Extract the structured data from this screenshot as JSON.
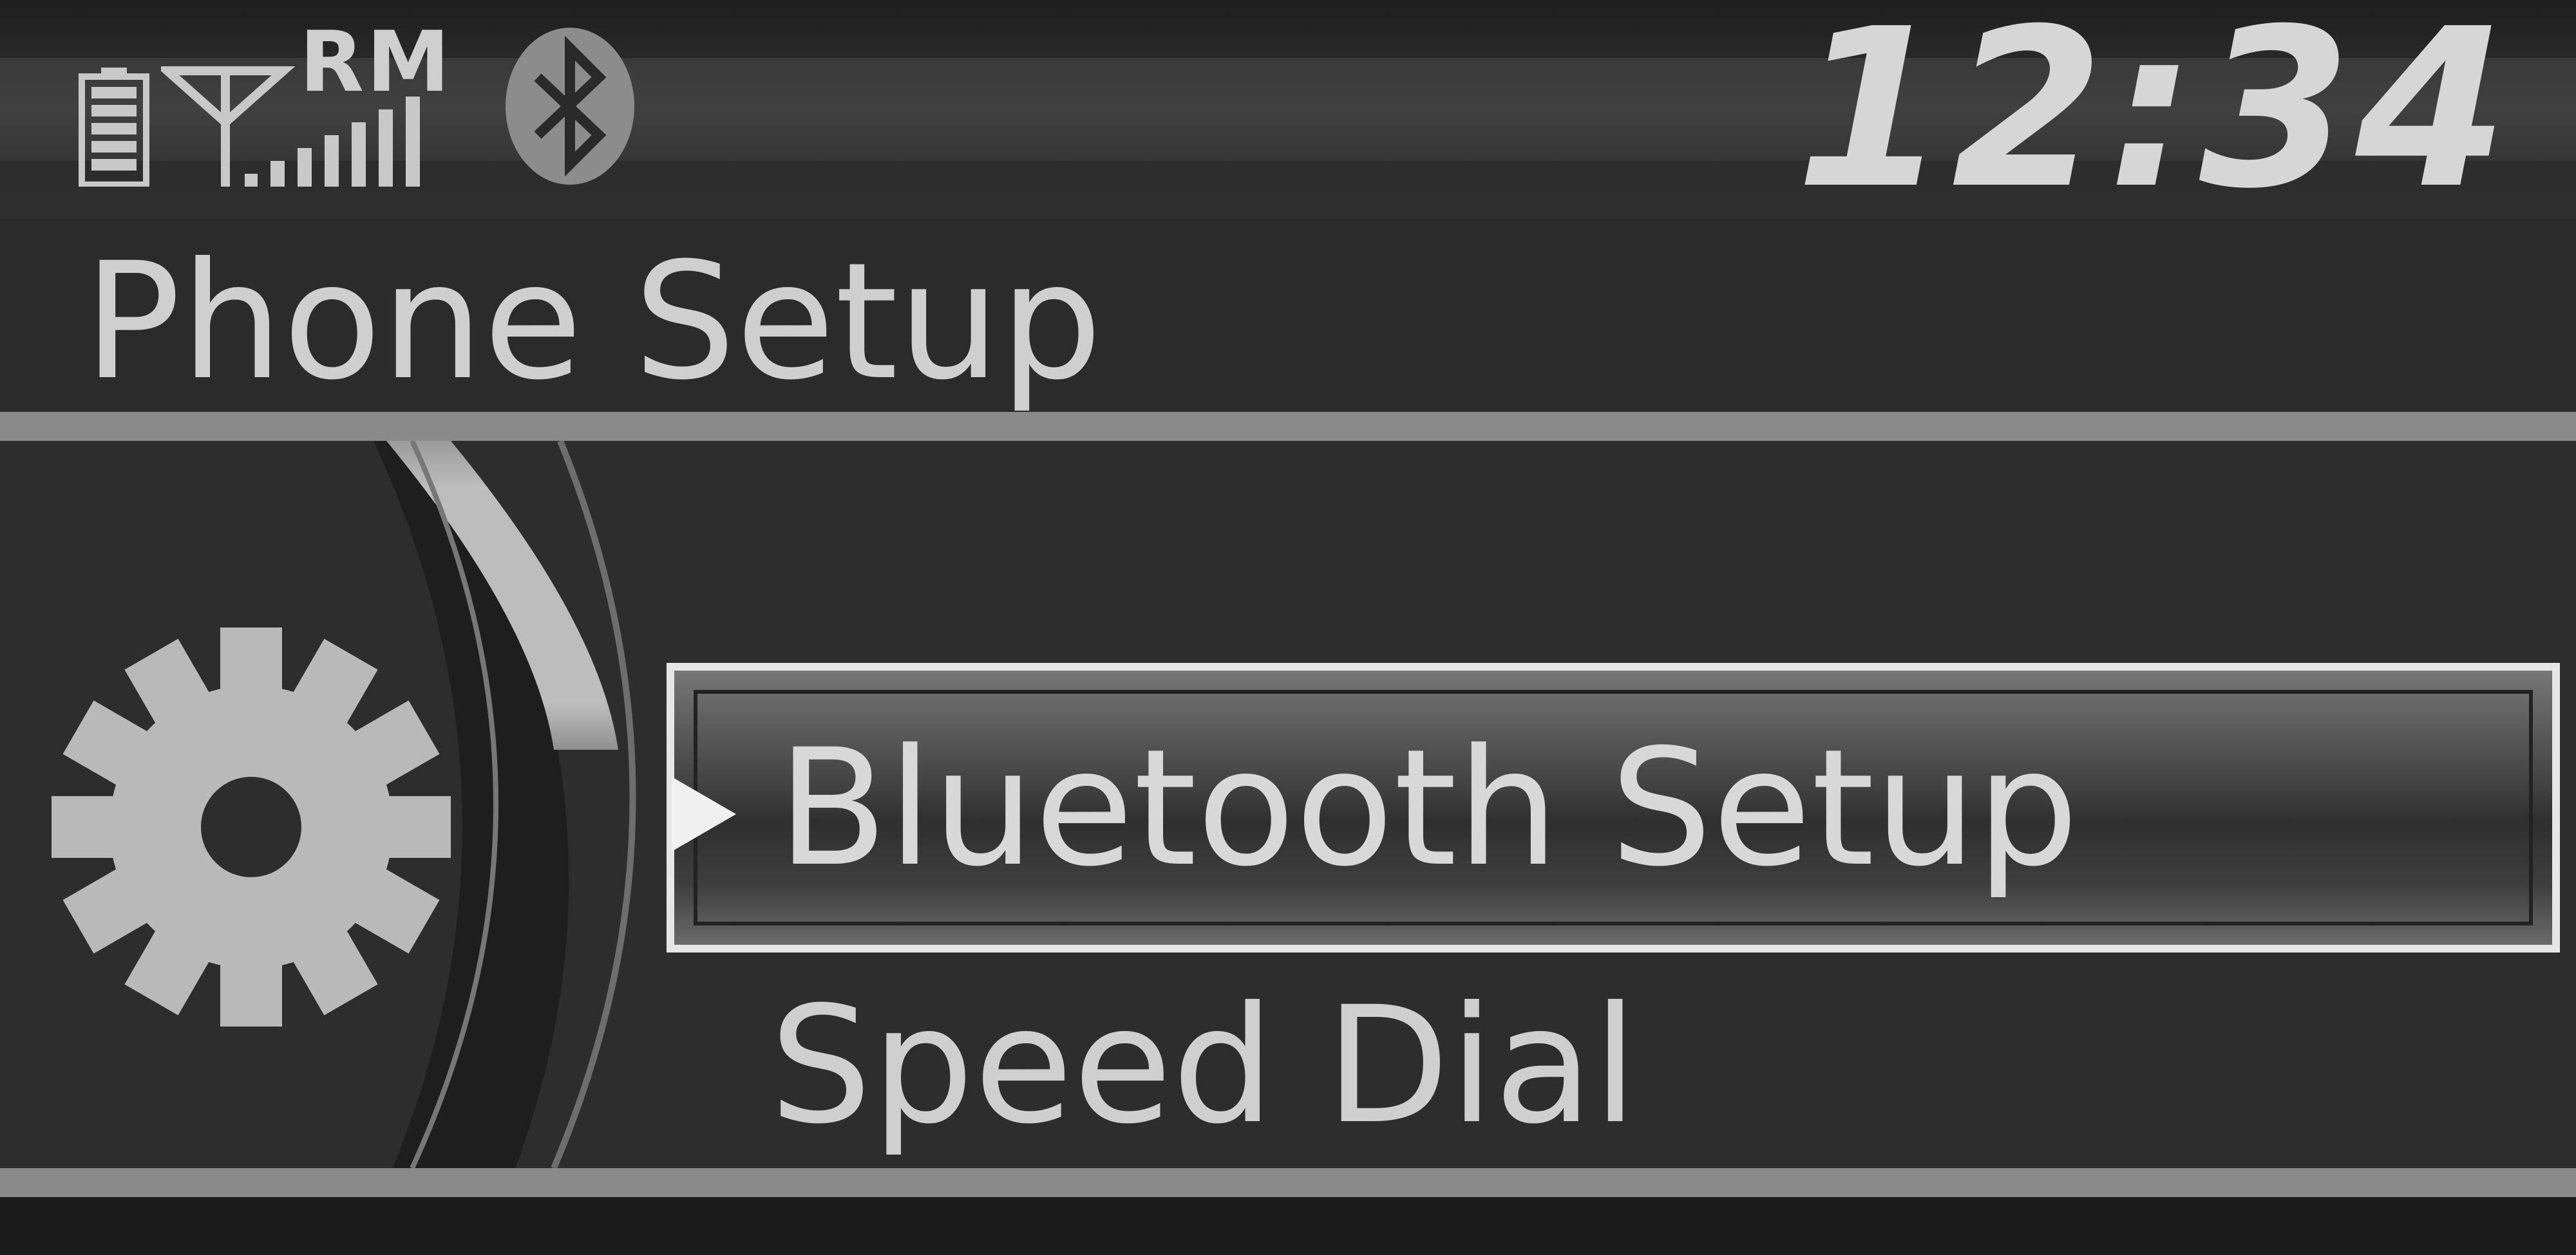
{
  "status": {
    "carrier": "RM",
    "time": "12:34",
    "icons": [
      "battery-icon",
      "signal-strength-icon",
      "bluetooth-icon"
    ]
  },
  "page": {
    "title": "Phone Setup"
  },
  "side_icon": "gear-icon",
  "menu": {
    "items": [
      {
        "label": "Bluetooth Setup",
        "selected": true
      },
      {
        "label": "Speed Dial",
        "selected": false
      }
    ]
  },
  "colors": {
    "background": "#2b2b2b",
    "text": "#cfcfcf",
    "divider": "#8a8a8a",
    "highlight_border": "#e6e6e6"
  }
}
